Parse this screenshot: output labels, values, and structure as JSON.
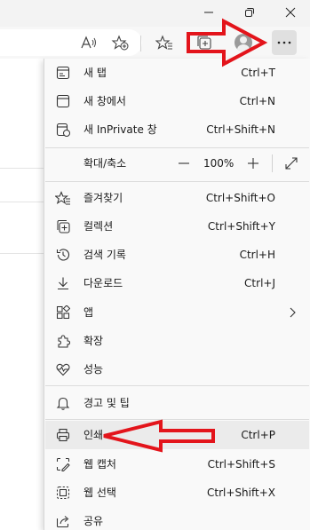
{
  "toolbar": {
    "read_aloud_icon": "read-aloud-icon",
    "add_favorite_icon": "add-favorite-icon",
    "favorites_icon": "favorites-icon",
    "collections_icon": "collections-icon",
    "profile_icon": "profile-icon",
    "more_icon": "more-icon"
  },
  "menu": {
    "items": [
      {
        "label": "새 탭",
        "shortcut": "Ctrl+T"
      },
      {
        "label": "새 창에서",
        "shortcut": "Ctrl+N"
      },
      {
        "label": "새 InPrivate 창",
        "shortcut": "Ctrl+Shift+N"
      },
      {
        "label": "즐겨찾기",
        "shortcut": "Ctrl+Shift+O"
      },
      {
        "label": "컬렉션",
        "shortcut": "Ctrl+Shift+Y"
      },
      {
        "label": "검색 기록",
        "shortcut": "Ctrl+H"
      },
      {
        "label": "다운로드",
        "shortcut": "Ctrl+J"
      },
      {
        "label": "앱",
        "shortcut": ""
      },
      {
        "label": "확장",
        "shortcut": ""
      },
      {
        "label": "성능",
        "shortcut": ""
      },
      {
        "label": "경고 및 팁",
        "shortcut": ""
      },
      {
        "label": "인쇄",
        "shortcut": "Ctrl+P"
      },
      {
        "label": "웹 캡처",
        "shortcut": "Ctrl+Shift+S"
      },
      {
        "label": "웹 선택",
        "shortcut": "Ctrl+Shift+X"
      },
      {
        "label": "공유",
        "shortcut": ""
      }
    ],
    "zoom": {
      "label": "확대/축소",
      "value": "100%",
      "minus": "—",
      "plus": "+"
    }
  },
  "colors": {
    "annotation_red": "#e3141b",
    "highlight": "#ebebeb"
  }
}
